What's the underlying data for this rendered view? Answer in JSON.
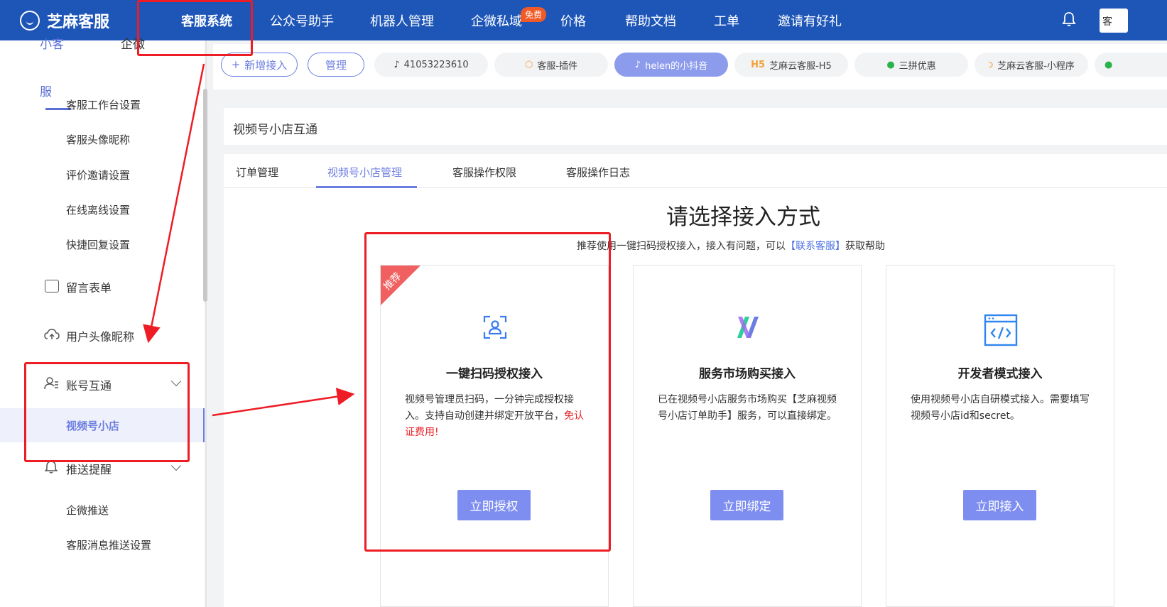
{
  "topbar": {
    "brand": "芝麻客服",
    "nav": [
      "客服系统",
      "公众号助手",
      "机器人管理",
      "企微私域",
      "价格",
      "帮助文档",
      "工单",
      "邀请有好礼"
    ],
    "free_badge": "免费",
    "right_box_text": "客",
    "bg_color": "#1e56b8"
  },
  "sidebar": {
    "tabs": [
      "小客",
      "企微",
      "服"
    ],
    "items": [
      "客服工作台设置",
      "客服头像昵称",
      "评价邀请设置",
      "在线离线设置",
      "快捷回复设置"
    ],
    "groups": [
      {
        "label": "留言表单",
        "icon": "form-icon"
      },
      {
        "label": "用户头像昵称",
        "icon": "cloud-upload-icon"
      },
      {
        "label": "账号互通",
        "icon": "users-icon"
      }
    ],
    "active_item": "视频号小店",
    "push_group": "推送提醒",
    "push_items": [
      "企微推送",
      "客服消息推送设置"
    ]
  },
  "channels": {
    "add": "新增接入",
    "manage": "管理",
    "pills": [
      "41053223610",
      "客服-插件",
      "helen的小抖音",
      "芝麻云客服-H5",
      "三拼优惠",
      "芝麻云客服-小程序"
    ],
    "h5_prefix": "H5"
  },
  "header": {
    "title": "视频号小店互通"
  },
  "tabs": [
    "订单管理",
    "视频号小店管理",
    "客服操作权限",
    "客服操作日志"
  ],
  "main": {
    "title": "请选择接入方式",
    "subtitle_pre": "推荐使用一键扫码授权接入，接入有问题，可以",
    "subtitle_link": "【联系客服】",
    "subtitle_post": "获取帮助"
  },
  "cards": [
    {
      "ribbon": "推荐",
      "title": "一键扫码授权接入",
      "desc": "视频号管理员扫码，一分钟完成授权接入。支持自动创建并绑定开放平台，",
      "desc_red": "免认证费用!",
      "button": "立即授权",
      "icon": "scan-user-icon"
    },
    {
      "title": "服务市场购买接入",
      "desc": "已在视频号小店服务市场购买【芝麻视频号小店订单助手】服务，可以直接绑定。",
      "button": "立即绑定",
      "icon": "market-logo-icon"
    },
    {
      "title": "开发者模式接入",
      "desc": "使用视频号小店自研模式接入。需要填写视频号小店id和secret。",
      "button": "立即接入",
      "icon": "code-window-icon"
    }
  ],
  "colors": {
    "accent": "#6c7ee1",
    "button": "#7e8ef0",
    "annotation": "#ee1c24",
    "link": "#4e71e3"
  }
}
